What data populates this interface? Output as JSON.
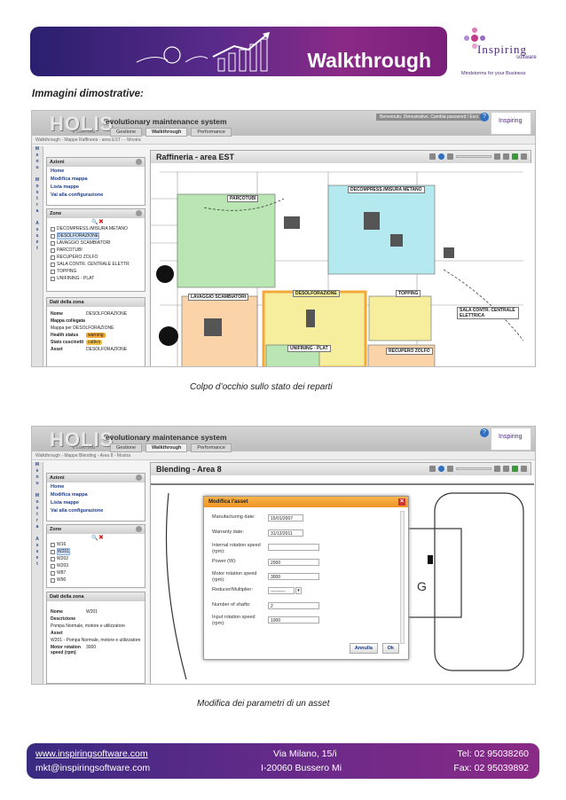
{
  "header": {
    "banner_title": "Walkthrough",
    "brand": "Inspiring",
    "brand_sub": "software",
    "tagline": "Mindstorms for your Business"
  },
  "section_title": "Immagini dimostrative:",
  "shot1": {
    "app": {
      "name": "HOLIS",
      "version": "v. 1.0RC 2014",
      "subtitle": "evolutionary maintenance system",
      "user_text": "Benvenuto, Dimostrativo. Cambia password / Esci",
      "help": "?"
    },
    "tabs": [
      "Gestione",
      "Walkthrough",
      "Performance"
    ],
    "breadcrumb": "Walkthrough - Mappe Raffineria - area EST - - Mostra",
    "menu_strip": "Menu Mostra Asset",
    "azioni": {
      "title": "Azioni",
      "items": [
        "Home",
        "Modifica mappa",
        "Lista mappe",
        "Vai alla configurazione"
      ]
    },
    "zone": {
      "title": "Zone",
      "items": [
        "DECOMPRESS./MISURA METANO",
        "DESOLFORAZIONE",
        "LAVAGGIO SCAMBIATORI",
        "PARCOTUBI",
        "RECUPERO ZOLFO",
        "SALA CONTR. CENTRALE ELETTR",
        "TOPPING",
        "UNIFINING - PLAT"
      ],
      "selected": 1
    },
    "dati": {
      "title": "Dati della zona",
      "rows": [
        {
          "k": "Nome",
          "v": "DESOLFORAZIONE"
        },
        {
          "k": "Mappa collegata",
          "v": ""
        },
        {
          "k": "",
          "v": "Mappa per DESOLFORAZIONE"
        },
        {
          "k": "Health status",
          "v": "warning"
        },
        {
          "k": "Stato cuscinetti",
          "v": "cattivo"
        },
        {
          "k": "Asset",
          "v": "DESOLFORAZIONE"
        }
      ]
    },
    "map_title": "Raffineria - area EST",
    "zones": [
      "DECOMPRESS./MISURA METANO",
      "PARCOTUBI",
      "LAVAGGIO SCAMBIATORI",
      "DESOLFORAZIONE",
      "TOPPING",
      "SALA CONTR. CENTRALE ELETTRICA",
      "UNIFINING - PLAT",
      "RECUPERO ZOLFO"
    ],
    "zone_colors": {
      "green": "#b9e6b3",
      "cyan": "#b4eaef",
      "orange": "#fad4a8",
      "yellow": "#f6ee9c",
      "warning": "#f2a83a"
    }
  },
  "caption1": "Colpo d’occhio sullo stato dei reparti",
  "shot2": {
    "breadcrumb": "Walkthrough - Mappe Blending - Area 8 - Mostra",
    "zone_items": [
      "W16",
      "W201",
      "W202",
      "W203",
      "W87",
      "W90"
    ],
    "zone_selected": 1,
    "dati": {
      "rows": [
        {
          "k": "Nome",
          "v": "W201"
        },
        {
          "k": "Descrizione",
          "v": ""
        },
        {
          "k": "",
          "v": "Pompa Normale, motore e utilizzatore"
        },
        {
          "k": "Asset",
          "v": ""
        },
        {
          "k": "",
          "v": "W201 - Pompa Normale, motore e utilizzatore"
        },
        {
          "k": "Motor rotation speed (rpm)",
          "v": "3000"
        }
      ]
    },
    "map_title": "Blending - Area 8",
    "dialog": {
      "title": "Modifica l'asset",
      "fields": [
        {
          "label": "Manufacturing date:",
          "value": "15/01/2007"
        },
        {
          "label": "Warranty date:",
          "value": "31/12/2011"
        },
        {
          "label": "Internal rotation speed (rpm):",
          "value": ""
        },
        {
          "label": "Power (W):",
          "value": "2000"
        },
        {
          "label": "Motor rotation speed (rpm):",
          "value": "3000"
        },
        {
          "label": "Reducer/Multiplier:",
          "value": "----------"
        },
        {
          "label": "Number of shafts:",
          "value": "2"
        },
        {
          "label": "Input rotation speed (rpm):",
          "value": "1000"
        }
      ],
      "cancel": "Annulla",
      "ok": "Ok"
    }
  },
  "caption2": "Modifica dei parametri di un asset",
  "footer": {
    "web": "www.inspiringsoftware.com",
    "mail": "mkt@inspiringsoftware.com",
    "street": "Via Milano, 15/i",
    "city": "I-20060 Bussero Mi",
    "tel": "Tel: 02 95038260",
    "fax": "Fax: 02 95039892"
  }
}
